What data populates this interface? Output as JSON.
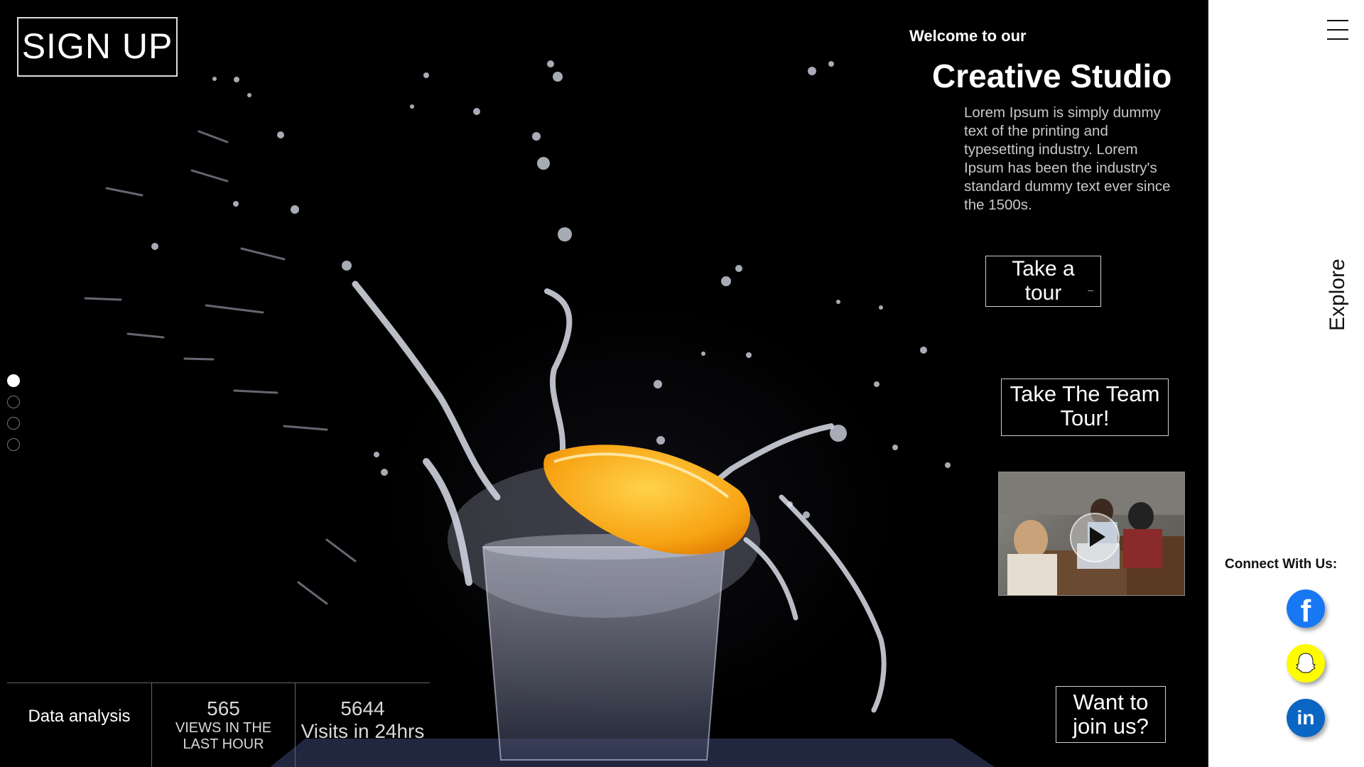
{
  "header": {
    "signup_label": "SIGN UP"
  },
  "intro": {
    "welcome": "Welcome to our",
    "title": "Creative Studio",
    "body": "Lorem Ipsum is simply dummy text of the printing and typesetting industry. Lorem Ipsum has been the industry's standard dummy text ever since the 1500s."
  },
  "buttons": {
    "tour_line1": "Take a",
    "tour_line2": "tour",
    "team_line1": "Take The Team",
    "team_line2": "Tour!",
    "join_line1": "Want to",
    "join_line2": "join us?"
  },
  "slider": {
    "total": 4,
    "active_index": 0
  },
  "stats": {
    "label": "Data analysis",
    "views_value": "565",
    "views_caption_1": "VIEWS IN THE",
    "views_caption_2": "LAST HOUR",
    "visits_value": "5644",
    "visits_caption": "Visits in 24hrs"
  },
  "sidebar": {
    "menu_icon": "hamburger-icon",
    "explore_label": "Explore",
    "connect_label": "Connect With Us:",
    "social": [
      {
        "name": "facebook-icon",
        "color": "#1877f2"
      },
      {
        "name": "snapchat-icon",
        "color": "#fffc00"
      },
      {
        "name": "linkedin-icon",
        "color": "#0a66c2"
      }
    ]
  },
  "colors": {
    "background": "#000000",
    "sidebar": "#ffffff",
    "accent_orange": "#f7a313"
  }
}
